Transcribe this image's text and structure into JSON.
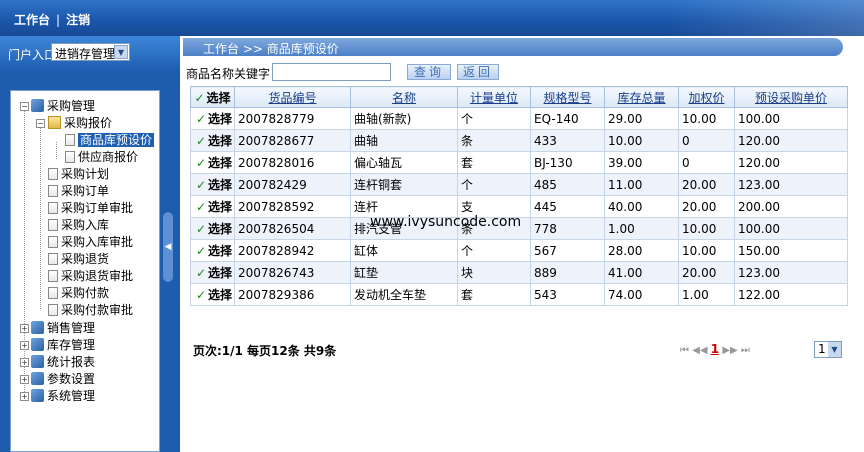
{
  "top": {
    "workbench": "工作台",
    "separator": "|",
    "logout": "注销"
  },
  "portal": {
    "label": "门户入口",
    "selected": "进销存管理"
  },
  "tree": {
    "purchase_mgmt": "采购管理",
    "purchase_quote": "采购报价",
    "product_preset_price": "商品库预设价",
    "supplier_quote": "供应商报价",
    "items": [
      "采购计划",
      "采购订单",
      "采购订单审批",
      "采购入库",
      "采购入库审批",
      "采购退货",
      "采购退货审批",
      "采购付款",
      "采购付款审批"
    ],
    "groups": [
      "销售管理",
      "库存管理",
      "统计报表",
      "参数设置",
      "系统管理"
    ]
  },
  "breadcrumb": "工作台 >> 商品库预设价",
  "search": {
    "label": "商品名称关键字：",
    "value": "",
    "query_button": "查询",
    "back_button": "返回"
  },
  "table": {
    "headers": [
      "选择",
      "货品编号",
      "名称",
      "计量单位",
      "规格型号",
      "库存总量",
      "加权价",
      "预设采购单价"
    ],
    "select_label": "选择",
    "rows": [
      [
        "2007828779",
        "曲轴(新款)",
        "个",
        "EQ-140",
        "29.00",
        "10.00",
        "100.00"
      ],
      [
        "2007828677",
        "曲轴",
        "条",
        "433",
        "10.00",
        "0",
        "120.00"
      ],
      [
        "2007828016",
        "偏心轴瓦",
        "套",
        "BJ-130",
        "39.00",
        "0",
        "120.00"
      ],
      [
        "200782429",
        "连杆铜套",
        "个",
        "485",
        "11.00",
        "20.00",
        "123.00"
      ],
      [
        "2007828592",
        "连杆",
        "支",
        "445",
        "40.00",
        "20.00",
        "200.00"
      ],
      [
        "2007826504",
        "排汽支管",
        "条",
        "778",
        "1.00",
        "10.00",
        "100.00"
      ],
      [
        "2007828942",
        "缸体",
        "个",
        "567",
        "28.00",
        "10.00",
        "150.00"
      ],
      [
        "2007826743",
        "缸垫",
        "块",
        "889",
        "41.00",
        "20.00",
        "123.00"
      ],
      [
        "2007829386",
        "发动机全车垫",
        "套",
        "543",
        "74.00",
        "1.00",
        "122.00"
      ]
    ]
  },
  "pagination": {
    "info": "页次:1/1 每页12条 共9条",
    "current": "1",
    "select_value": "1"
  },
  "watermark": "www.ivysuncode.com"
}
